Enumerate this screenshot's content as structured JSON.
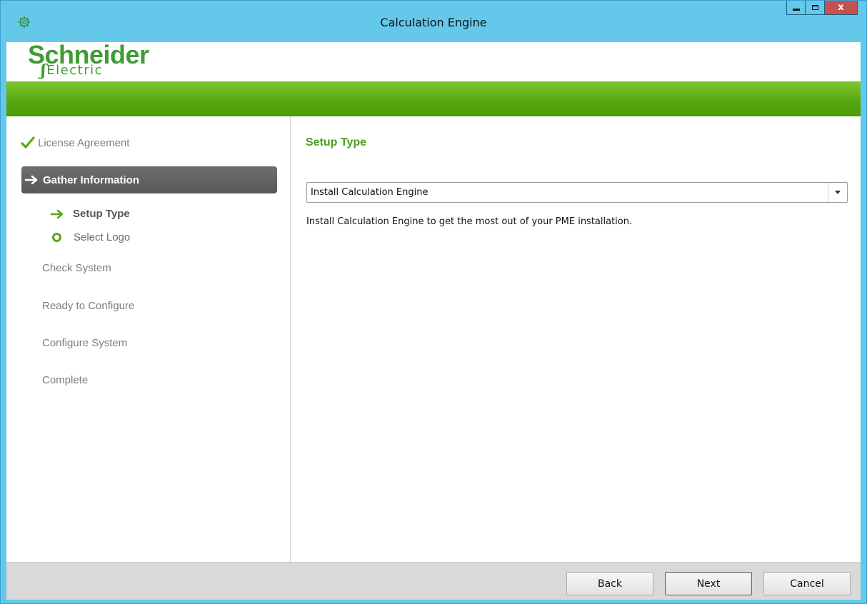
{
  "window": {
    "title": "Calculation Engine",
    "close_label": "x"
  },
  "brand": {
    "name": "Schneider",
    "sub": "Electric",
    "color": "#3f9c35"
  },
  "sidebar": {
    "steps": [
      {
        "label": "License Agreement",
        "state": "complete"
      },
      {
        "label": "Gather Information",
        "state": "active"
      },
      {
        "label": "Check System",
        "state": "pending"
      },
      {
        "label": "Ready to Configure",
        "state": "pending"
      },
      {
        "label": "Configure System",
        "state": "pending"
      },
      {
        "label": "Complete",
        "state": "pending"
      }
    ],
    "substeps": [
      {
        "label": "Setup Type",
        "state": "current"
      },
      {
        "label": "Select Logo",
        "state": "pending"
      }
    ]
  },
  "main": {
    "title": "Setup Type",
    "setup_select": {
      "value": "Install Calculation Engine"
    },
    "description": "Install Calculation Engine to get the most out of your PME installation."
  },
  "footer": {
    "back_label": "Back",
    "next_label": "Next",
    "cancel_label": "Cancel"
  },
  "icons": {
    "app": "gear-icon",
    "complete": "checkmark-icon",
    "active": "arrow-right-icon",
    "pending_substep": "circle-icon"
  },
  "colors": {
    "titlebar": "#64c8ea",
    "accent_green": "#4aa01c",
    "active_step_bg": "#606060",
    "footer_bg": "#d9d9d9",
    "close_button": "#c75050"
  }
}
